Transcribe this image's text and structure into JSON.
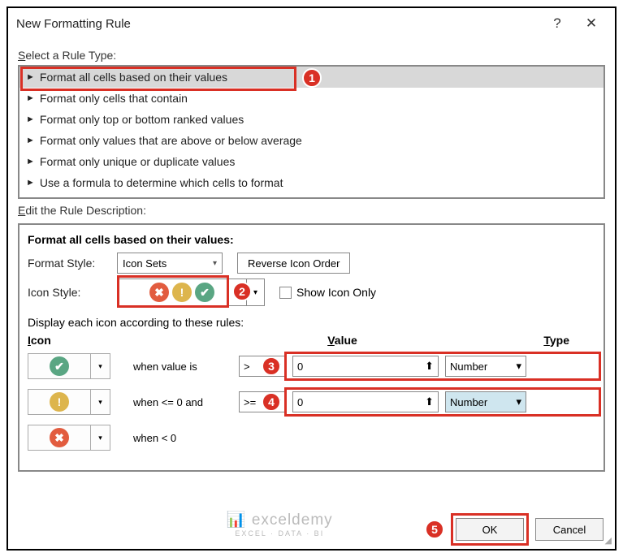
{
  "title": "New Formatting Rule",
  "section_select": "Select a Rule Type:",
  "rule_types": [
    "Format all cells based on their values",
    "Format only cells that contain",
    "Format only top or bottom ranked values",
    "Format only values that are above or below average",
    "Format only unique or duplicate values",
    "Use a formula to determine which cells to format"
  ],
  "section_edit": "Edit the Rule Description:",
  "header": "Format all cells based on their values:",
  "format_style_label": "Format Style:",
  "format_style_value": "Icon Sets",
  "reverse_btn": "Reverse Icon Order",
  "icon_style_label": "Icon Style:",
  "show_icon_only": "Show Icon Only",
  "display_rules": "Display each icon according to these rules:",
  "columns": {
    "icon": "Icon",
    "value": "Value",
    "type": "Type"
  },
  "rows": [
    {
      "when": "when value is",
      "op": ">",
      "val": "0",
      "type": "Number"
    },
    {
      "when": "when <= 0 and",
      "op": ">=",
      "val": "0",
      "type": "Number"
    },
    {
      "when": "when < 0",
      "op": "",
      "val": "",
      "type": ""
    }
  ],
  "ok": "OK",
  "cancel": "Cancel",
  "watermark": "exceldemy",
  "watermark_sub": "EXCEL · DATA · BI",
  "badges": [
    "1",
    "2",
    "3",
    "4",
    "5"
  ]
}
